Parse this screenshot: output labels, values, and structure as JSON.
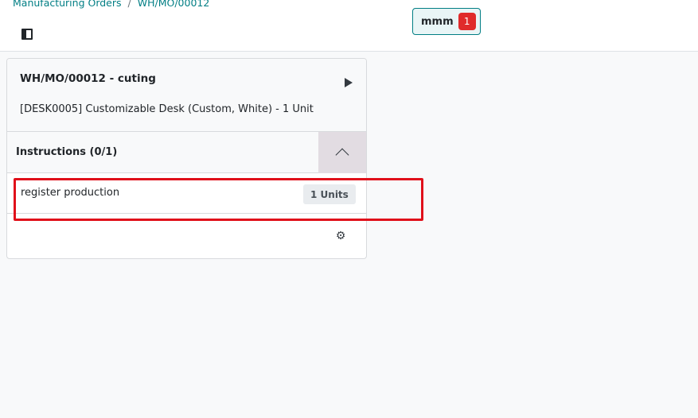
{
  "breadcrumb": {
    "parent": "Manufacturing Orders",
    "separator": "/",
    "current": "WH/MO/00012"
  },
  "employee": {
    "name": "mmm",
    "count": "1"
  },
  "card": {
    "title": "WH/MO/00012 - cuting",
    "product": "[DESK0005] Customizable Desk (Custom, White) - 1 Unit",
    "instructions_label": "Instructions (0/1)",
    "steps": [
      {
        "name": "register production",
        "qty": "1 Units"
      }
    ]
  },
  "icons": {
    "panel_toggle": "panel-toggle-icon",
    "play": "play-icon",
    "collapse": "chevron-up-icon",
    "settings": "gear-icon"
  },
  "colors": {
    "accent": "#017e84",
    "badge": "#e02b2b",
    "highlight": "#e0101a"
  }
}
